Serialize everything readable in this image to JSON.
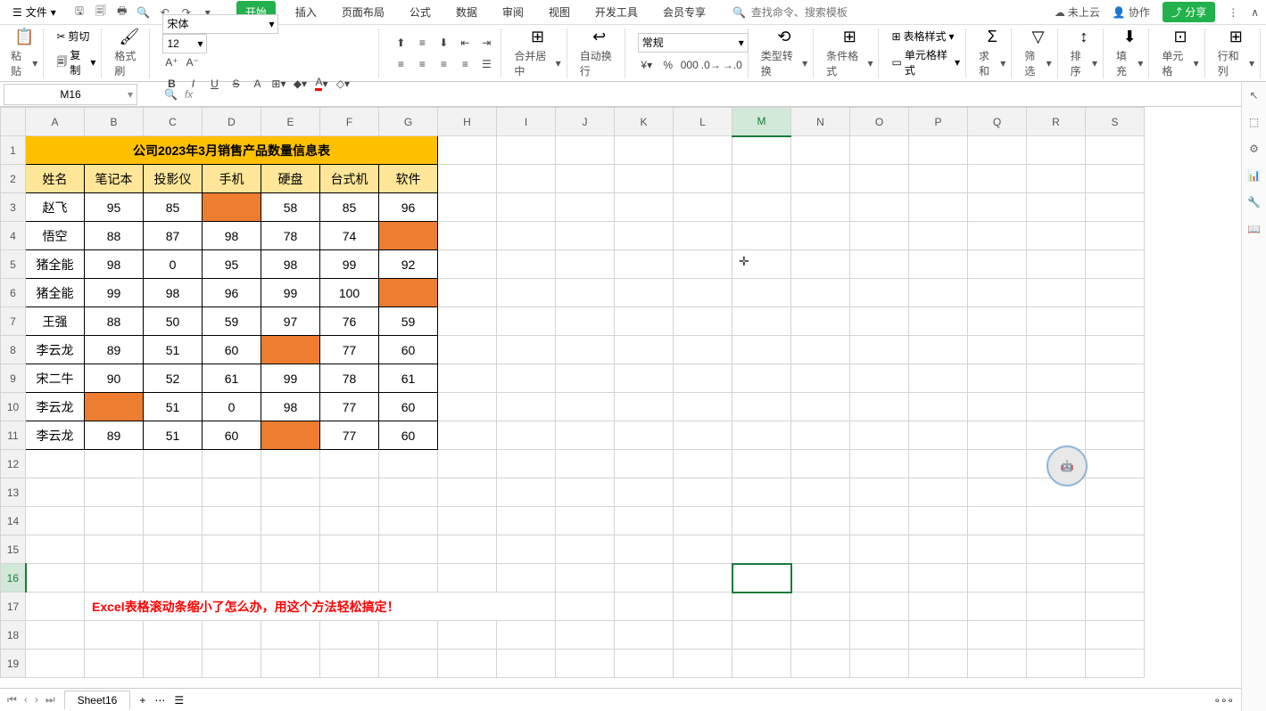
{
  "menubar": {
    "file_label": "文件",
    "tabs": [
      "开始",
      "插入",
      "页面布局",
      "公式",
      "数据",
      "审阅",
      "视图",
      "开发工具",
      "会员专享"
    ],
    "active_tab": 0,
    "search_placeholder": "查找命令、搜索模板",
    "cloud_status": "未上云",
    "collab_label": "协作",
    "share_label": "分享"
  },
  "ribbon": {
    "paste_label": "粘贴",
    "cut_label": "剪切",
    "copy_label": "复制",
    "format_painter_label": "格式刷",
    "font_name": "宋体",
    "font_size": "12",
    "merge_label": "合并居中",
    "wrap_label": "自动换行",
    "number_format": "常规",
    "type_convert_label": "类型转换",
    "cond_format_label": "条件格式",
    "table_style_label": "表格样式",
    "cell_style_label": "单元格样式",
    "sum_label": "求和",
    "filter_label": "筛选",
    "sort_label": "排序",
    "fill_label": "填充",
    "cell_label": "单元格",
    "rowcol_label": "行和列"
  },
  "namebox": {
    "cell_ref": "M16",
    "fx": "fx"
  },
  "columns": [
    "A",
    "B",
    "C",
    "D",
    "E",
    "F",
    "G",
    "H",
    "I",
    "J",
    "K",
    "L",
    "M",
    "N",
    "O",
    "P",
    "Q",
    "R",
    "S"
  ],
  "row_count": 19,
  "selected": {
    "col": "M",
    "row": 16
  },
  "table": {
    "title": "公司2023年3月销售产品数量信息表",
    "headers": [
      "姓名",
      "笔记本",
      "投影仪",
      "手机",
      "硬盘",
      "台式机",
      "软件"
    ],
    "rows": [
      {
        "name": "赵飞",
        "vals": [
          "95",
          "85",
          "",
          "58",
          "85",
          "96"
        ],
        "orange": [
          2
        ]
      },
      {
        "name": "悟空",
        "vals": [
          "88",
          "87",
          "98",
          "78",
          "74",
          ""
        ],
        "orange": [
          5
        ]
      },
      {
        "name": "猪全能",
        "vals": [
          "98",
          "0",
          "95",
          "98",
          "99",
          "92"
        ],
        "orange": []
      },
      {
        "name": "猪全能",
        "vals": [
          "99",
          "98",
          "96",
          "99",
          "100",
          ""
        ],
        "orange": [
          5
        ]
      },
      {
        "name": "王强",
        "vals": [
          "88",
          "50",
          "59",
          "97",
          "76",
          "59"
        ],
        "orange": []
      },
      {
        "name": "李云龙",
        "vals": [
          "89",
          "51",
          "60",
          "",
          "77",
          "60"
        ],
        "orange": [
          3
        ]
      },
      {
        "name": "宋二牛",
        "vals": [
          "90",
          "52",
          "61",
          "99",
          "78",
          "61"
        ],
        "orange": []
      },
      {
        "name": "李云龙",
        "vals": [
          "",
          "51",
          "0",
          "98",
          "77",
          "60"
        ],
        "orange": [
          0
        ]
      },
      {
        "name": "李云龙",
        "vals": [
          "89",
          "51",
          "60",
          "",
          "77",
          "60"
        ],
        "orange": [
          3
        ]
      }
    ],
    "note_row": 17,
    "note": "Excel表格滚动条缩小了怎么办，用这个方法轻松搞定！"
  },
  "statusbar": {
    "sheet_name": "Sheet16"
  }
}
